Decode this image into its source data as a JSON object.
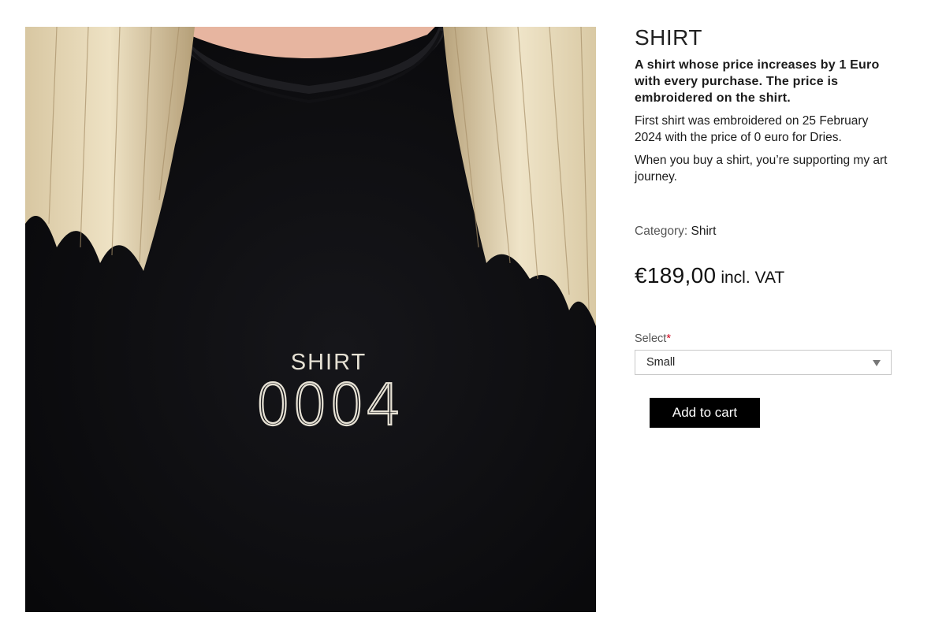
{
  "product": {
    "image_alt_icon": "product-photo",
    "embroidery_word": "SHIRT",
    "embroidery_number": "0004",
    "title": "SHIRT",
    "lead": "A shirt whose price increases by 1 Euro with every purchase. The price is embroidered on the shirt.",
    "paragraph_1": "First shirt was embroidered on 25 February 2024 with the price of 0 euro for Dries.",
    "paragraph_2": "When you buy a shirt, you’re supporting my art journey.",
    "category_label": "Category:",
    "category_value": "Shirt",
    "price": "€189,00",
    "price_suffix": "incl. VAT"
  },
  "form": {
    "select_label": "Select",
    "required_mark": "*",
    "selected_size": "Small",
    "add_to_cart_label": "Add to cart"
  },
  "colors": {
    "shirt": "#0d0d0f",
    "button": "#000000",
    "required": "#d0021b"
  }
}
